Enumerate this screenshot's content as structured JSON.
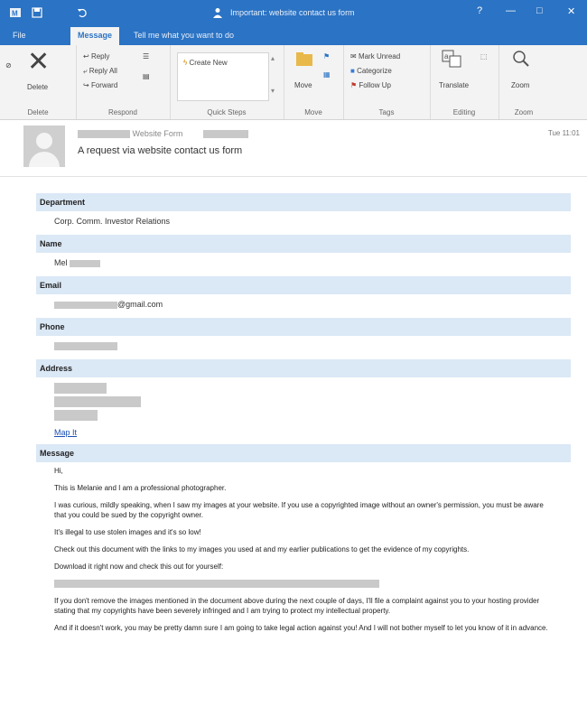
{
  "window": {
    "title": "Important: website contact us form",
    "controls": [
      "?",
      "—",
      "□",
      "✕"
    ]
  },
  "tabs": [
    {
      "label": "File"
    },
    {
      "label": "Message",
      "active": true
    },
    {
      "label": "Tell me what you want to do"
    }
  ],
  "ribbon": {
    "delete": {
      "label": "Delete",
      "group": "Delete"
    },
    "respond": {
      "reply": "Reply",
      "reply_all": "Reply All",
      "forward": "Forward",
      "group": "Respond"
    },
    "quick_steps": {
      "item": "Create New",
      "group": "Quick Steps"
    },
    "move": {
      "move": "Move",
      "group": "Move"
    },
    "tags": {
      "mark": "Mark Unread",
      "categorize": "Categorize",
      "follow": "Follow Up",
      "group": "Tags"
    },
    "editing": {
      "translate": "Translate",
      "group": "Editing"
    },
    "zoom": {
      "zoom": "Zoom",
      "group": "Zoom"
    }
  },
  "message": {
    "from": "Website Form",
    "subject": "A request via website contact us form",
    "date": "Tue 11:01"
  },
  "form": {
    "department": {
      "label": "Department",
      "value": "Corp. Comm. Investor Relations"
    },
    "name": {
      "label": "Name",
      "value": "Mel"
    },
    "email": {
      "label": "Email",
      "value": "@gmail.com"
    },
    "phone": {
      "label": "Phone"
    },
    "address": {
      "label": "Address",
      "map_link": "Map It"
    },
    "message": {
      "label": "Message",
      "paragraphs": [
        "Hi,",
        "This is Melanie and I am a professional photographer.",
        "I was curious, mildly speaking, when I saw my images at your website. If you use a copyrighted image without an owner's permission, you must be aware that you could be sued by the copyright owner.",
        "It's illegal to use stolen images and it's so low!",
        "Check out this document with the links to my images you used at and my earlier publications to get the evidence of my copyrights.",
        "Download it right now and check this out for yourself:",
        "",
        "If you don't remove the images mentioned in the document above during the next couple of days, I'll file a complaint against you to your hosting provider stating that my copyrights have been severely infringed and I am trying to protect my intellectual property.",
        "And if it doesn't work, you may be pretty damn sure I am going to take legal action against you! And I will not bother myself to let you know of it in advance."
      ]
    }
  },
  "colors": {
    "titlebar": "#2b73c4",
    "ribbon": "#f3f3f3",
    "field_header": "#dbe8f6",
    "link": "#1a4fb3"
  }
}
